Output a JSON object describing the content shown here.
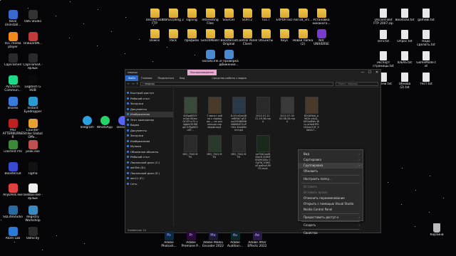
{
  "desktop_left": [
    {
      "label": "Revo Uninstall...",
      "color": "#3a6ad0"
    },
    {
      "label": "OBS Studio",
      "color": "#333"
    },
    {
      "label": "VLC media player",
      "color": "#f08a1c"
    },
    {
      "label": "OnboardM...",
      "color": "#c03a3a"
    },
    {
      "label": "CapFrameX",
      "color": "#2a2a2a"
    },
    {
      "label": "CapFrameX - ярлык",
      "color": "#2a2a2a"
    },
    {
      "label": "PyCharm Commun...",
      "color": "#21d789"
    },
    {
      "label": "Logitech G HUB",
      "color": "#0a0a0a"
    },
    {
      "label": "Sharex",
      "color": "#3a7ad8"
    },
    {
      "label": "Instant Eyedropper",
      "color": "#2a9ad0"
    },
    {
      "label": "MSI AFTERBURNER",
      "color": "#c02020"
    },
    {
      "label": "Counter-Strike Global Offe...",
      "color": "#e8a030"
    },
    {
      "label": "uTorrent Pro",
      "color": "#3a8a3a"
    },
    {
      "label": "peak.exe",
      "color": "#c05050"
    },
    {
      "label": "Boosteroid",
      "color": "#3a4ad0"
    },
    {
      "label": "Figma",
      "color": "#111"
    },
    {
      "label": "AnyDesk.exe",
      "color": "#e04040"
    },
    {
      "label": "Taskbar.exe - ярлык",
      "color": "#eee"
    },
    {
      "label": "SQLiteStudio",
      "color": "#2a6aa0"
    },
    {
      "label": "Registry Workshop",
      "color": "#3a8ac0"
    },
    {
      "label": "Atom Lab",
      "color": "#2a7ad8"
    },
    {
      "label": "Obfocity",
      "color": "#2a2a2a"
    }
  ],
  "desktop_top": [
    {
      "label": "Discord Bot FTP",
      "type": "folder"
    },
    {
      "label": "Obfuscating 2",
      "type": "folder"
    },
    {
      "label": "signing",
      "type": "folder"
    },
    {
      "label": "Interesting Files",
      "type": "folder"
    },
    {
      "label": "Sources",
      "type": "folder"
    },
    {
      "label": "SORT2",
      "type": "folder"
    },
    {
      "label": "ТЕСТ",
      "type": "folder"
    },
    {
      "label": "EXPORTED",
      "type": "folder"
    },
    {
      "label": "non18_vrc...",
      "type": "folder"
    },
    {
      "label": "Установка никакого...",
      "type": "folder"
    }
  ],
  "desktop_row2": [
    {
      "label": "Downs",
      "type": "folder"
    },
    {
      "label": "Pack",
      "type": "folder"
    },
    {
      "label": "профили",
      "type": "folder"
    },
    {
      "label": "GenshMods!",
      "type": "folder"
    },
    {
      "label": "Boosteroid Original",
      "type": "folder"
    },
    {
      "label": "Control Panel Client",
      "type": "folder"
    },
    {
      "label": "Объекты",
      "type": "folder"
    },
    {
      "label": "Keys",
      "type": "folder"
    },
    {
      "label": "Новая папка (2)",
      "type": "folder"
    },
    {
      "label": "NIV UNIVERSE",
      "type": "app"
    }
  ],
  "desktop_row3": [
    {
      "label": "sisnafo.lnk",
      "type": "file"
    },
    {
      "label": "3) Проверка движения...",
      "type": "file"
    }
  ],
  "desktop_right": [
    {
      "label": "Discord Bot FTP 2007.zip"
    },
    {
      "label": "BoostOSI.txt"
    },
    {
      "label": "gamebl.txt"
    },
    {
      "label": "serv.txt"
    },
    {
      "label": "Опрос.txt"
    },
    {
      "label": "Надо сделать.txt"
    },
    {
      "label": "Экспорт страницы.txt"
    },
    {
      "label": "IDEAS.txt"
    },
    {
      "label": "GameMode.txt"
    },
    {
      "label": "задачи.txt"
    },
    {
      "label": "Обнова (2).txt"
    },
    {
      "label": "тест.txt"
    }
  ],
  "desktop_mid": [
    {
      "label": "Telegram",
      "color": "#2aa0e0"
    },
    {
      "label": "WhatsApp",
      "color": "#25d366"
    },
    {
      "label": "Discord",
      "color": "#5865f2"
    }
  ],
  "recycle_label": "Корзина",
  "window": {
    "title": "людець",
    "ribbon_tab": "Воспроизведение",
    "ribbon_sub": "Средства работы с видео",
    "ribbon": [
      "Файл",
      "Главная",
      "Поделиться",
      "Вид"
    ],
    "address": "› людець",
    "search": "Поиск: людець",
    "controls": [
      "—",
      "☐",
      "✕"
    ],
    "nav": [
      {
        "label": "Быстрый доступ",
        "sel": false
      },
      {
        "label": "Рабочий стол",
        "sel": false
      },
      {
        "label": "Загрузки",
        "sel": false
      },
      {
        "label": "Документы",
        "sel": false
      },
      {
        "label": "Изображения",
        "sel": true
      },
      {
        "label": "Этот компьютер",
        "sel": false
      },
      {
        "label": "Видео",
        "sel": false
      },
      {
        "label": "Документы",
        "sel": false
      },
      {
        "label": "Загрузки",
        "sel": false
      },
      {
        "label": "Изображения",
        "sel": false
      },
      {
        "label": "Музыка",
        "sel": false
      },
      {
        "label": "Объемные объекты",
        "sel": false
      },
      {
        "label": "Рабочий стол",
        "sel": false
      },
      {
        "label": "Локальный диск (C:)",
        "sel": false
      },
      {
        "label": "winTah (D:)",
        "sel": false
      },
      {
        "label": "Локальный диск (E:)",
        "sel": false
      },
      {
        "label": "win11 (F:)",
        "sel": false
      },
      {
        "label": "Сеть",
        "sel": false
      }
    ],
    "files": [
      {
        "name": "4EEgdEEZYm0pr 8AmsOCXTf-x7S x4gbbVGH9Rqd 9-PJqi6Z2uXT...",
        "color": "#3a4a3a"
      },
      {
        "name": "7 минут хайпа с сервером — не коллекция серверов.mp4",
        "color": "#4a3a2a"
      },
      {
        "name": "8-47crDxk48mRf3b7 qFZuxGYE4BB98 ANWKGi7mPHUs 42sdl8dnf.mp4",
        "color": "#2a3a4a"
      },
      {
        "name": "2022-07-21 21-19-36.mp4",
        "color": "#2a2a2a"
      },
      {
        "name": "2022-07-30 00-08-34.mp4",
        "color": "#3a3a3a"
      },
      {
        "name": "B2QtINkA_b9d2e p9yA_NFOw6Wv WLc-sGb4HPG tG2wrOQF_9 SbSA7...",
        "color": "#4a3a2a"
      },
      {
        "name": "IMG_7040.MP4",
        "color": "#2a2a2a"
      },
      {
        "name": "IMG_7041.MP4",
        "color": "#2a3a2a"
      },
      {
        "name": "IMG_7042.MP4",
        "color": "#2a2a2a"
      },
      {
        "name": "ocF5AOuoWZwVR ZGfNTKiWHQ5Xv CFgTW_V3KOs0 gz6xvIUMFG.mp4",
        "color": "#1a2a1a"
      }
    ],
    "status": "Элементов: 10"
  },
  "context_menu": [
    {
      "label": "Вид",
      "arrow": true,
      "disabled": false
    },
    {
      "label": "Сортировка",
      "arrow": true,
      "disabled": false
    },
    {
      "label": "Группировка",
      "arrow": true,
      "disabled": false,
      "hl": true
    },
    {
      "label": "Обновить",
      "arrow": false,
      "disabled": false
    },
    {
      "sep": true
    },
    {
      "label": "Настроить папку...",
      "arrow": false,
      "disabled": false
    },
    {
      "sep": true
    },
    {
      "label": "Вставить",
      "arrow": false,
      "disabled": true
    },
    {
      "label": "Вставить ярлык",
      "arrow": false,
      "disabled": true
    },
    {
      "label": "Отменить переименование",
      "arrow": false,
      "disabled": false
    },
    {
      "label": "Открыть с помощью Visual Studio",
      "arrow": false,
      "disabled": false
    },
    {
      "label": "Nvidia Control Panel",
      "arrow": false,
      "disabled": false
    },
    {
      "sep": true
    },
    {
      "label": "Предоставить доступ к",
      "arrow": true,
      "disabled": false
    },
    {
      "sep": true
    },
    {
      "label": "Создать",
      "arrow": true,
      "disabled": false
    },
    {
      "sep": true
    },
    {
      "label": "Свойства",
      "arrow": false,
      "disabled": false
    }
  ],
  "taskbar": [
    {
      "label": "Adobe Photosh...",
      "glyph": "Ps",
      "color": "#0a2a4a"
    },
    {
      "label": "Adobe Premiere P...",
      "glyph": "Pr",
      "color": "#2a0a3a"
    },
    {
      "label": "Adobe Media Encoder 2022",
      "glyph": "Me",
      "color": "#1a1a3a"
    },
    {
      "label": "Adobe Audition...",
      "glyph": "Au",
      "color": "#0a2a2a"
    },
    {
      "label": "Adobe After Effects 2022",
      "glyph": "Ae",
      "color": "#2a1a4a"
    }
  ]
}
